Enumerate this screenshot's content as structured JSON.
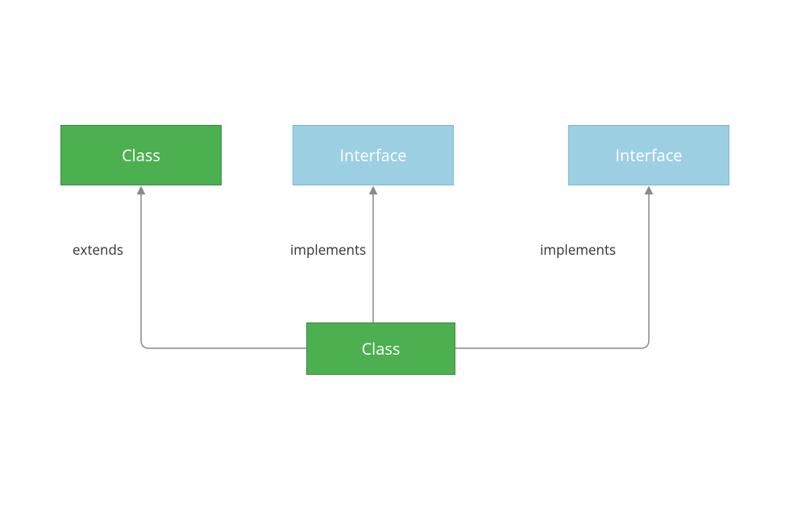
{
  "diagram": {
    "nodes": {
      "parentClass": {
        "label": "Class",
        "type": "class"
      },
      "interface1": {
        "label": "Interface",
        "type": "interface"
      },
      "interface2": {
        "label": "Interface",
        "type": "interface"
      },
      "childClass": {
        "label": "Class",
        "type": "class"
      }
    },
    "edges": {
      "extends": {
        "label": "extends"
      },
      "implements1": {
        "label": "implements"
      },
      "implements2": {
        "label": "implements"
      }
    },
    "colors": {
      "class": "#4caf50",
      "interface": "#9dcfe3",
      "connector": "#8a8a8a",
      "text": "#ffffff",
      "label": "#333333"
    }
  }
}
